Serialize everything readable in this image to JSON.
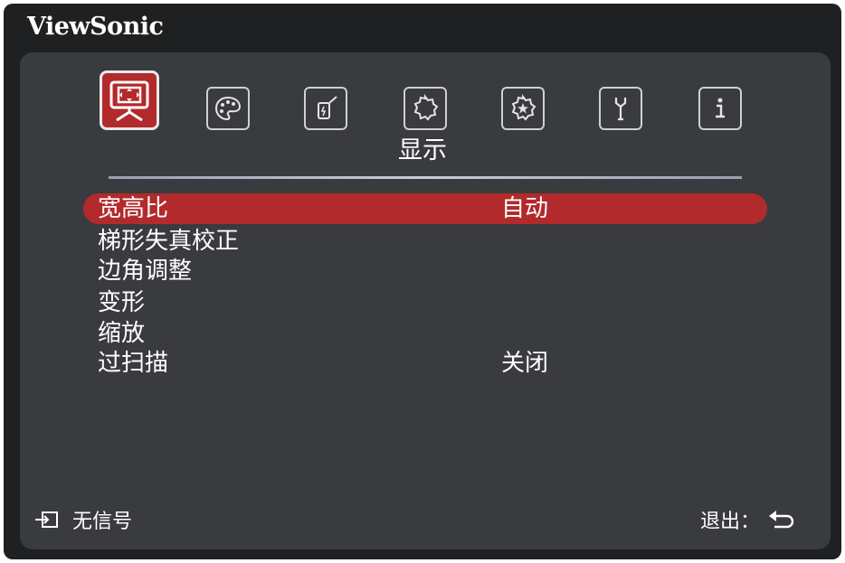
{
  "brand": "ViewSonic",
  "tabs": [
    {
      "icon": "display-icon",
      "active": true
    },
    {
      "icon": "palette-icon",
      "active": false
    },
    {
      "icon": "power-setting-icon",
      "active": false
    },
    {
      "icon": "basic-gear-icon",
      "active": false
    },
    {
      "icon": "advanced-gear-icon",
      "active": false
    },
    {
      "icon": "wrench-icon",
      "active": false
    },
    {
      "icon": "info-icon",
      "active": false
    }
  ],
  "section_title": "显示",
  "menu": [
    {
      "label": "宽高比",
      "value": "自动",
      "selected": true
    },
    {
      "label": "梯形失真校正",
      "value": "",
      "selected": false
    },
    {
      "label": "边角调整",
      "value": "",
      "selected": false
    },
    {
      "label": "变形",
      "value": "",
      "selected": false
    },
    {
      "label": "缩放",
      "value": "",
      "selected": false
    },
    {
      "label": "过扫描",
      "value": "关闭",
      "selected": false
    }
  ],
  "footer": {
    "source_icon": "input-source-icon",
    "source_text": "无信号",
    "exit_text": "退出：",
    "exit_icon": "return-arrow-icon"
  },
  "colors": {
    "accent": "#b22a2b",
    "panel": "#393b3e",
    "frame": "#1f2022"
  }
}
